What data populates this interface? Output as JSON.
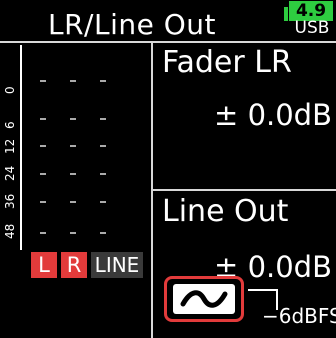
{
  "header": {
    "title": "LR/Line Out",
    "battery": {
      "level": "4.9",
      "source": "USB",
      "color": "#2ecc40"
    }
  },
  "meter": {
    "scale_labels": [
      "48",
      "36",
      "24",
      "12",
      "6",
      "0"
    ],
    "channels": [
      {
        "label": "L",
        "color": "#e23b3b"
      },
      {
        "label": "R",
        "color": "#e23b3b"
      },
      {
        "label": "LINE",
        "color": "#3a3a3a"
      }
    ]
  },
  "fader": {
    "title": "Fader LR",
    "value": "± 0.0dB"
  },
  "line_out": {
    "title": "Line Out",
    "value": "± 0.0dB"
  },
  "limiter": {
    "icon": "curve-icon",
    "threshold": "−6dBFS",
    "accent": "#e23b3b"
  }
}
